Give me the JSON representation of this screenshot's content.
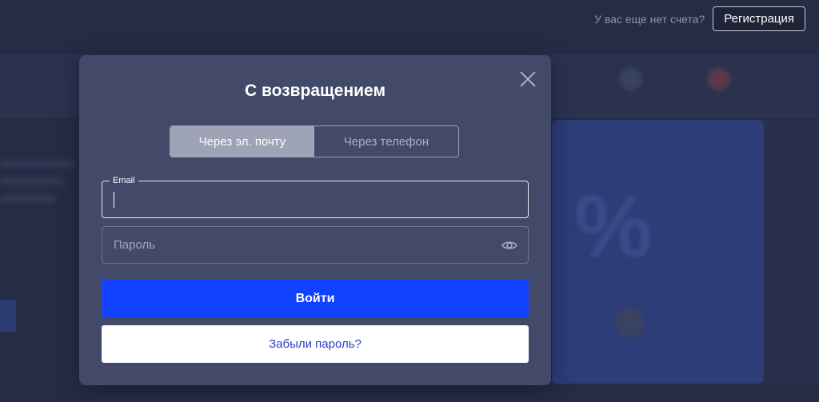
{
  "header": {
    "no_account_text": "У вас еще нет счета?",
    "register_label": "Регистрация"
  },
  "modal": {
    "title": "С возвращением",
    "tabs": [
      {
        "label": "Через эл. почту",
        "active": true
      },
      {
        "label": "Через телефон",
        "active": false
      }
    ],
    "email": {
      "label": "Email",
      "value": ""
    },
    "password": {
      "placeholder": "Пароль",
      "value": ""
    },
    "login_label": "Войти",
    "forgot_label": "Забыли пароль?"
  },
  "icons": {
    "close": "close-icon",
    "password_toggle": "eye-icon"
  },
  "colors": {
    "page_background": "#262c44",
    "modal_background": "#434a69",
    "primary_button": "#1142ff",
    "link_text": "#2a3fc8"
  }
}
